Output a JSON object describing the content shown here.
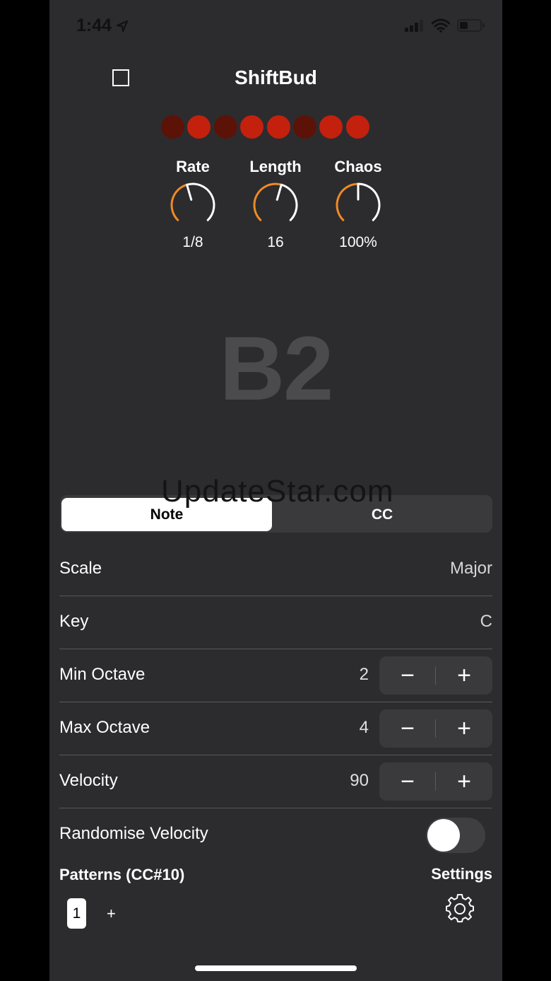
{
  "status_bar": {
    "time": "1:44"
  },
  "header": {
    "title": "ShiftBud"
  },
  "steps": [
    {
      "active": false,
      "color": "#5c1207"
    },
    {
      "active": true,
      "color": "#c4200e"
    },
    {
      "active": false,
      "color": "#5c1207"
    },
    {
      "active": true,
      "color": "#c4200e"
    },
    {
      "active": true,
      "color": "#c4200e"
    },
    {
      "active": false,
      "color": "#5c1207"
    },
    {
      "active": true,
      "color": "#c4200e"
    },
    {
      "active": true,
      "color": "#c4200e"
    }
  ],
  "knobs": {
    "rate": {
      "label": "Rate",
      "value": "1/8",
      "level": 0.44
    },
    "length": {
      "label": "Length",
      "value": "16",
      "level": 0.56
    },
    "chaos": {
      "label": "Chaos",
      "value": "100%",
      "level": 0.5
    }
  },
  "current_note": "B2",
  "watermark": "UpdateStar.com",
  "segmented": {
    "note": "Note",
    "cc": "CC",
    "selected": "note"
  },
  "settings": {
    "scale": {
      "label": "Scale",
      "value": "Major"
    },
    "key": {
      "label": "Key",
      "value": "C"
    },
    "min_octave": {
      "label": "Min Octave",
      "value": "2"
    },
    "max_octave": {
      "label": "Max Octave",
      "value": "4"
    },
    "velocity": {
      "label": "Velocity",
      "value": "90"
    },
    "randomise_velocity": {
      "label": "Randomise Velocity",
      "on": false
    }
  },
  "stepper": {
    "minus": "−",
    "plus": "+"
  },
  "bottom": {
    "patterns_title": "Patterns (CC#10)",
    "settings_title": "Settings",
    "pattern": "1",
    "add": "+"
  },
  "colors": {
    "accent": "#f08a24",
    "background": "#2c2c2e",
    "step_on": "#c4200e",
    "step_off": "#5c1207"
  }
}
